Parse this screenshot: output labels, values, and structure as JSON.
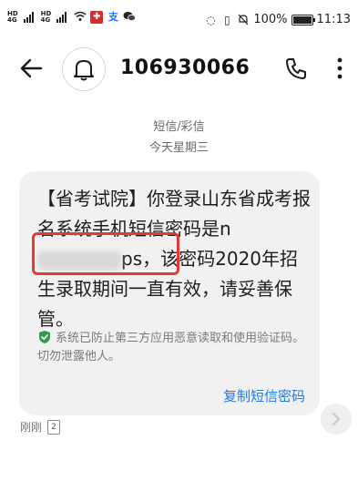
{
  "status_bar": {
    "signal1_label": "HD",
    "signal1_net": "4G",
    "signal2_label": "HD",
    "signal2_net": "4G",
    "battery_percent": "100%",
    "battery_level": 1.0,
    "time": "11:13"
  },
  "header": {
    "title": "106930066"
  },
  "meta": {
    "type_label": "短信/彩信",
    "day_label": "今天星期三"
  },
  "message": {
    "text_part1": "【省考试院】你登录山东省成考报名系统手机短信密码是n",
    "text_part2": "ps，该密码2020年招生录取期间一直有效，请妥善保管。",
    "security_notice": "系统已防止第三方应用恶意读取和使用验证码。切勿泄露他人。",
    "copy_action": "复制短信密码"
  },
  "footer": {
    "sent_time": "刚刚",
    "sim_slot": "2"
  },
  "colors": {
    "accent": "#1f7be0",
    "highlight_box": "#e53935",
    "bubble_bg": "#f1f1f1"
  }
}
